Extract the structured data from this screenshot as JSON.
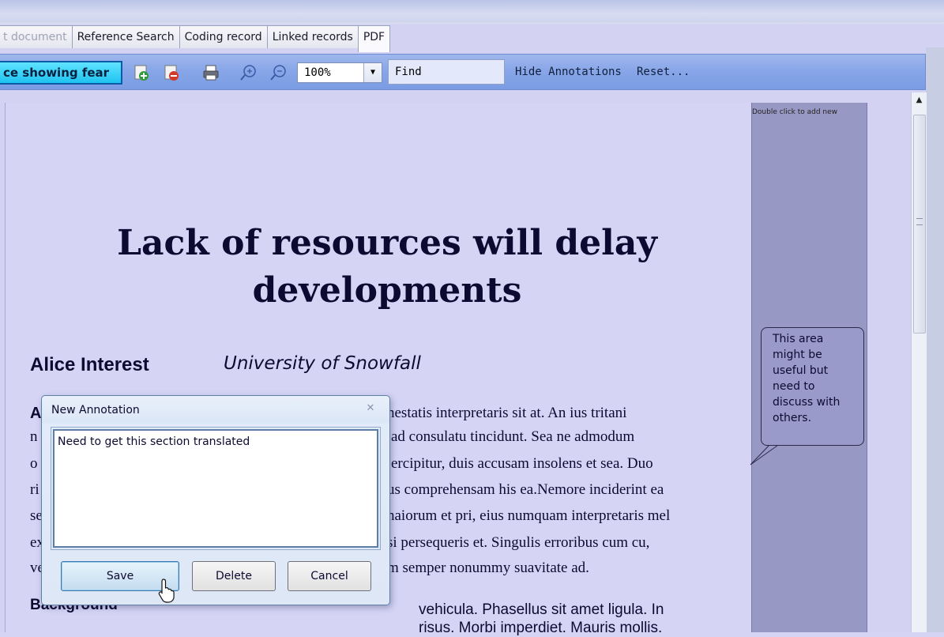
{
  "tabs": [
    {
      "label": "t document"
    },
    {
      "label": "Reference Search"
    },
    {
      "label": "Coding record"
    },
    {
      "label": "Linked records"
    },
    {
      "label": "PDF"
    }
  ],
  "toolbar": {
    "code_label": "ce showing fear",
    "zoom": "100%",
    "find_value": "Find",
    "hide_annotations": "Hide Annotations",
    "reset": "Reset..."
  },
  "annotation_panel": {
    "hint": "Double click to add new",
    "note_lines": [
      "This area",
      "might be",
      "useful but",
      "need to",
      "discuss with",
      "others."
    ]
  },
  "document": {
    "title_line1": "Lack of resources will delay",
    "title_line2": "developments",
    "author": "Alice Interest",
    "affiliation": "University of Snowfall",
    "abstract_letter": "A",
    "lines": [
      {
        "left": "",
        "right": "nestatis interpretaris sit at. An ius tritani"
      },
      {
        "left": "n",
        "right": "ad consulatu tincidunt. Sea ne admodum"
      },
      {
        "left": "o",
        "right": "ercipitur, duis accusam insolens et sea. Duo"
      },
      {
        "left": "ri",
        "right": "us comprehensam his ea.Nemore inciderint ea"
      },
      {
        "left": "se",
        "right": "naiorum et pri, eius numquam interpretaris mel"
      },
      {
        "left": "ex",
        "right": "si persequeris et. Singulis erroribus cum cu,"
      },
      {
        "left": "ve",
        "right": "m semper nonummy suavitate ad."
      }
    ],
    "background_heading": "Background",
    "col2_lines": [
      "vehicula. Phasellus sit amet ligula. In",
      "risus. Morbi imperdiet. Mauris mollis."
    ]
  },
  "dialog": {
    "title": "New Annotation",
    "text": "Need to get this section translated",
    "save": "Save",
    "delete": "Delete",
    "cancel": "Cancel"
  }
}
